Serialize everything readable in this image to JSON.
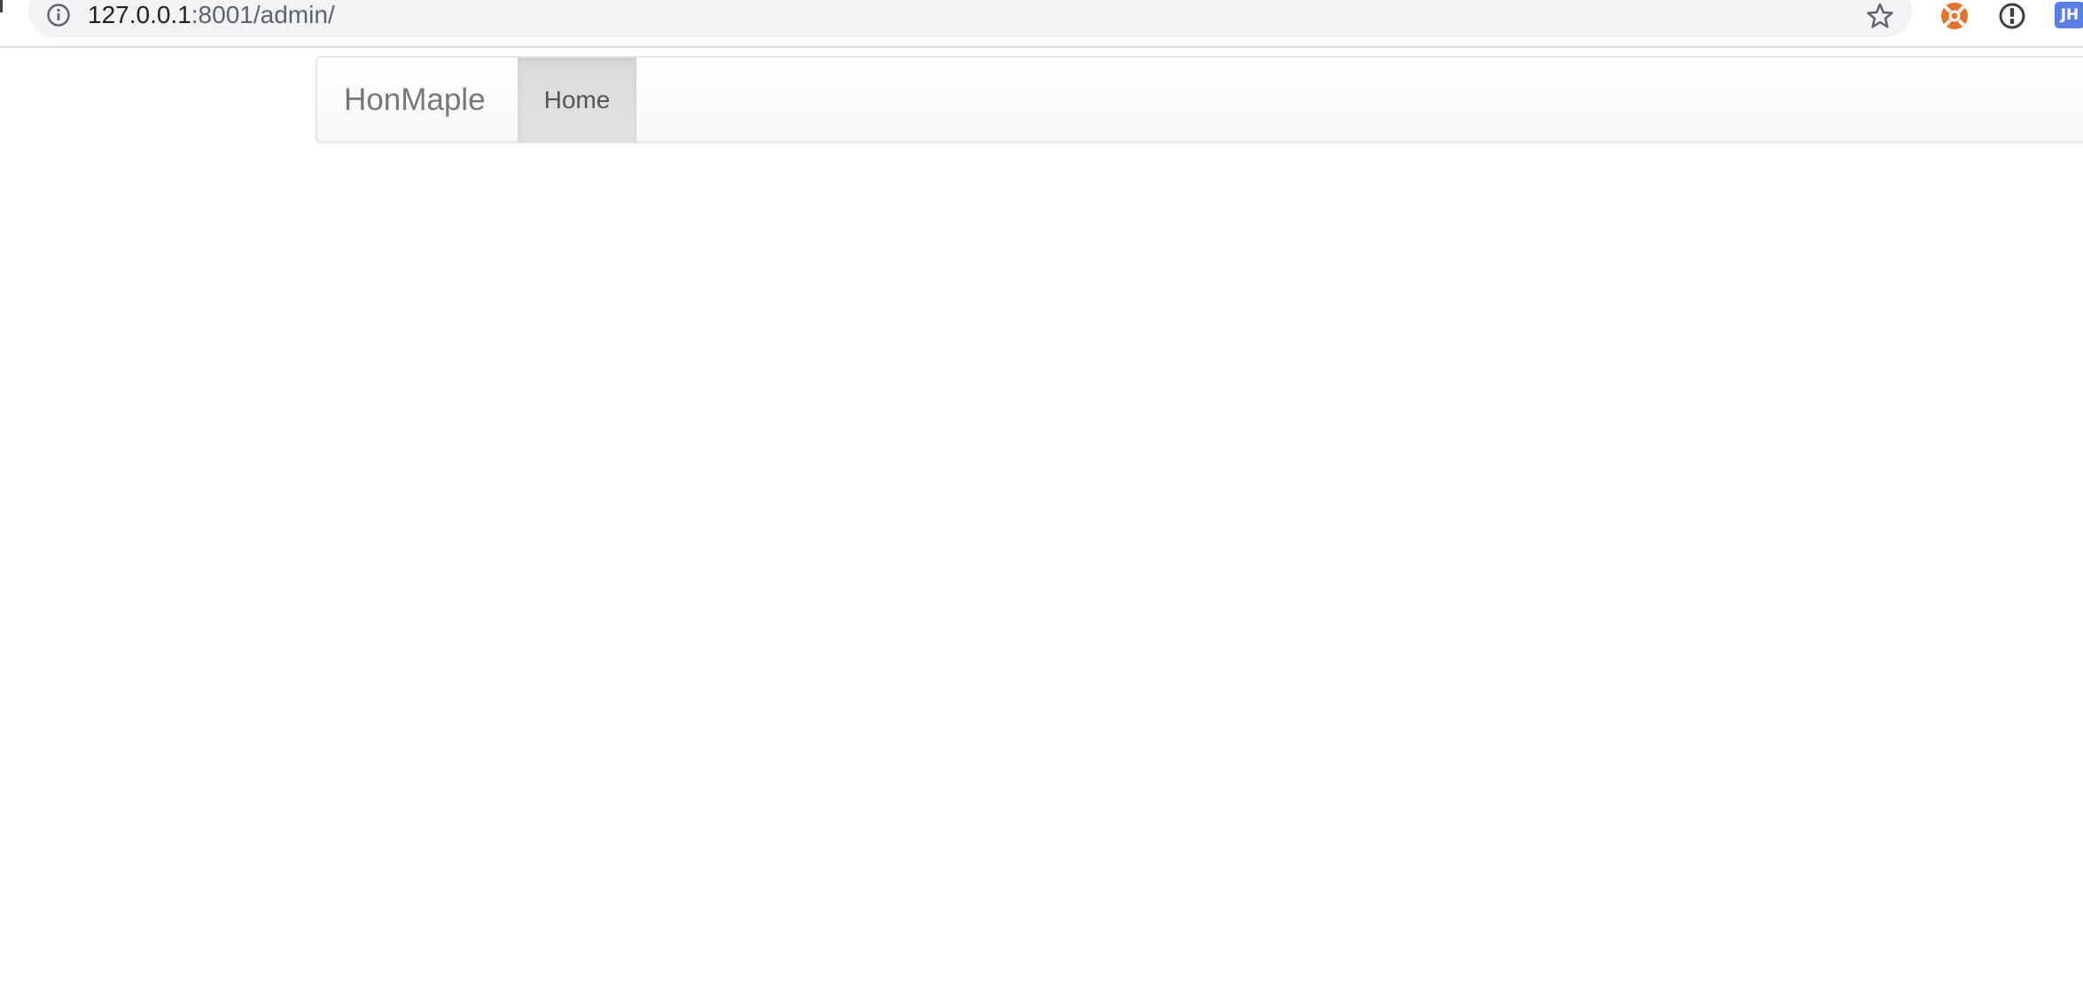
{
  "browser": {
    "url_host": "127.0.0.1",
    "url_rest": ":8001/admin/",
    "icons": {
      "info": "info-icon",
      "bookmark": "star-icon",
      "ext1": "lifebuoy-icon",
      "ext2": "password-manager-icon",
      "ext3": "jh-extension-icon"
    },
    "ext3_label": "JH",
    "colors": {
      "omnibox_bg": "#f1f3f4",
      "lifebuoy_orange": "#e8712a",
      "jh_blue": "#5b7de8"
    }
  },
  "navbar": {
    "brand": "HonMaple",
    "items": [
      {
        "label": "Home",
        "active": true
      }
    ]
  }
}
